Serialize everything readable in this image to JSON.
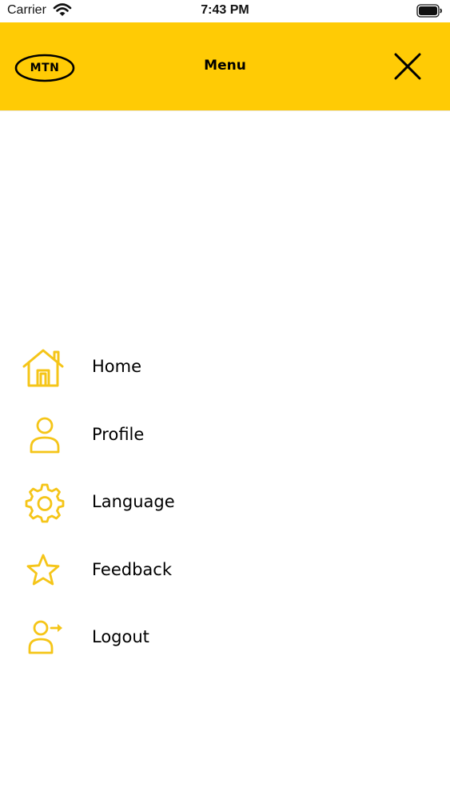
{
  "status_bar": {
    "carrier": "Carrier",
    "time": "7:43 PM"
  },
  "header": {
    "logo_text": "MTN",
    "title": "Menu"
  },
  "menu": {
    "items": [
      {
        "label": "Home",
        "icon": "home-icon"
      },
      {
        "label": "Profile",
        "icon": "user-icon"
      },
      {
        "label": "Language",
        "icon": "gear-icon"
      },
      {
        "label": "Feedback",
        "icon": "star-icon"
      },
      {
        "label": "Logout",
        "icon": "logout-icon"
      }
    ]
  },
  "colors": {
    "brand_yellow": "#ffcb05",
    "icon_yellow": "#f5c518",
    "text": "#000000",
    "background": "#ffffff"
  }
}
